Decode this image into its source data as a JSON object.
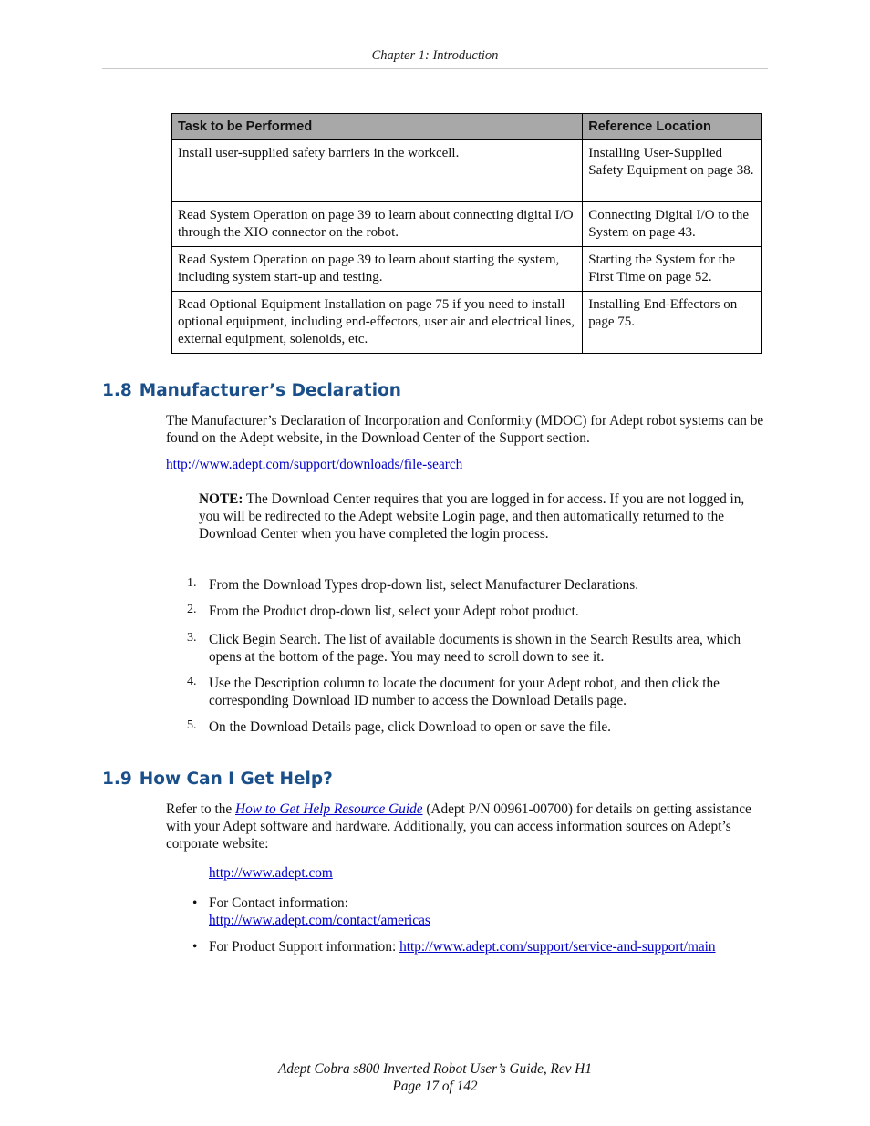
{
  "header": {
    "chapter": "Chapter 1: Introduction"
  },
  "task_table": {
    "columns": [
      "Task to be Performed",
      "Reference Location"
    ],
    "rows": [
      {
        "task": "Install user-supplied safety barriers in the workcell.",
        "reference": "Installing User-Supplied Safety Equipment on page 38."
      },
      {
        "task": "Read System Operation on page 39 to learn about connecting digital I/O through the XIO connector on the robot.",
        "reference": "Connecting Digital I/O to the System on page 43."
      },
      {
        "task": "Read System Operation on page 39 to learn about starting the system, including system start-up and testing.",
        "reference": "Starting the System for the First Time on page 52."
      },
      {
        "task": "Read Optional Equipment Installation on page 75 if you need to install optional equipment, including end-effectors, user air and electrical lines, external equipment, solenoids, etc.",
        "reference": "Installing End-Effectors on page 75."
      }
    ]
  },
  "section_1_8": {
    "number": "1.8",
    "title": "Manufacturer’s Declaration",
    "intro": "The Manufacturer’s Declaration of Incorporation and Conformity (MDOC) for Adept robot systems can be found on the Adept website, in the Download Center of the Support section.",
    "link": "http://www.adept.com/support/downloads/file-search",
    "note_label": "NOTE:",
    "note_text": " The Download Center requires that you are logged in for access. If you are not logged in, you will be redirected to the Adept website Login page, and then automatically returned to the Download Center when you have completed the login process.",
    "steps": [
      {
        "n": "1.",
        "text": "From the Download Types drop-down list, select Manufacturer Declarations."
      },
      {
        "n": "2.",
        "text": "From the Product drop-down list, select your Adept robot product."
      },
      {
        "n": "3.",
        "text": "Click Begin Search. The list of available documents is shown in the Search Results area, which opens at the bottom of the page. You may need to scroll down to see it."
      },
      {
        "n": "4.",
        "text": "Use the Description column to locate the document for your Adept robot, and then click the corresponding Download ID number to access the Download Details page."
      },
      {
        "n": "5.",
        "text": "On the Download Details page, click Download to open or save the file."
      }
    ]
  },
  "section_1_9": {
    "number": "1.9",
    "title": "How Can I Get Help?",
    "intro_prefix": "Refer to the ",
    "guide_link": "How to Get Help Resource Guide",
    "intro_suffix": " (Adept P/N 00961-00700) for details on getting assistance with your Adept software and hardware. Additionally, you can access information sources on Adept’s corporate website:",
    "main_link": "http://www.adept.com",
    "bullets": [
      {
        "label": "For Contact information:",
        "link": "http://www.adept.com/contact/americas"
      },
      {
        "label": "For Product Support information: ",
        "link": "http://www.adept.com/support/service-and-support/main"
      }
    ]
  },
  "footer": {
    "guide_title": "Adept Cobra s800 Inverted Robot User’s Guide, Rev H1",
    "page": "Page 17 of 142"
  },
  "colors": {
    "heading": "#1a4f8a",
    "link": "#0000cc",
    "table_header_bg": "#a8a8a8"
  }
}
